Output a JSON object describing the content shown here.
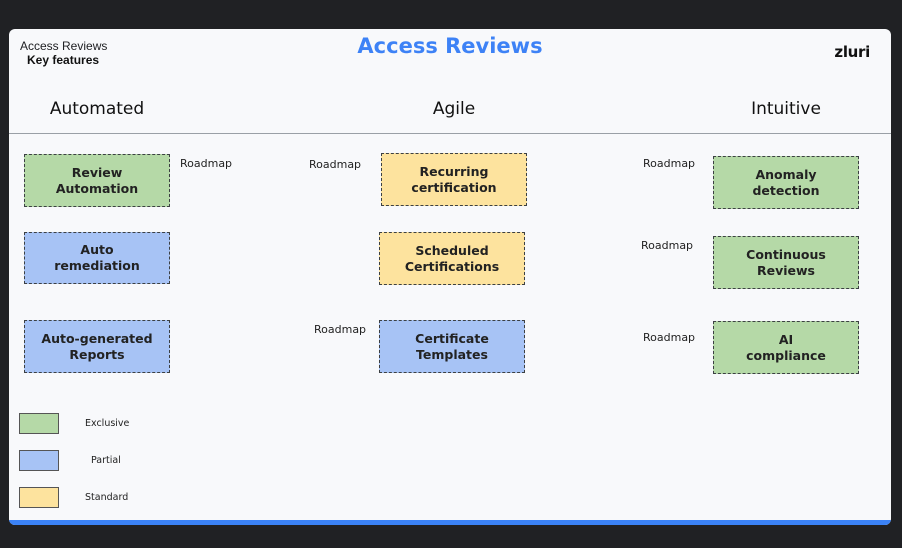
{
  "header": {
    "section_label": "Access Reviews",
    "section_sublabel": "Key features",
    "title": "Access Reviews",
    "logo_text": "zluri"
  },
  "columns": {
    "automated": "Automated",
    "agile": "Agile",
    "intuitive": "Intuitive"
  },
  "features": {
    "review_automation": {
      "label_line1": "Review",
      "label_line2": "Automation",
      "roadmap": "Roadmap",
      "status": "Exclusive"
    },
    "auto_remediation": {
      "label_line1": "Auto",
      "label_line2": "remediation",
      "status": "Partial"
    },
    "auto_generated_reports": {
      "label_line1": "Auto-generated",
      "label_line2": "Reports",
      "status": "Partial"
    },
    "recurring_certification": {
      "label_line1": "Recurring",
      "label_line2": "certification",
      "roadmap": "Roadmap",
      "status": "Standard"
    },
    "scheduled_certifications": {
      "label_line1": "Scheduled",
      "label_line2": "Certifications",
      "status": "Standard"
    },
    "certificate_templates": {
      "label_line1": "Certificate",
      "label_line2": "Templates",
      "roadmap": "Roadmap",
      "status": "Partial"
    },
    "anomaly_detection": {
      "label_line1": "Anomaly",
      "label_line2": "detection",
      "roadmap": "Roadmap",
      "status": "Exclusive"
    },
    "continuous_reviews": {
      "label_line1": "Continuous",
      "label_line2": "Reviews",
      "roadmap": "Roadmap",
      "status": "Exclusive"
    },
    "ai_compliance": {
      "label_line1": "AI",
      "label_line2": "compliance",
      "roadmap": "Roadmap",
      "status": "Exclusive"
    }
  },
  "legend": {
    "exclusive": {
      "label": "Exclusive",
      "color": "#b5d9a7"
    },
    "partial": {
      "label": "Partial",
      "color": "#a7c3f5"
    },
    "standard": {
      "label": "Standard",
      "color": "#fde39e"
    }
  },
  "colors": {
    "accent": "#3d82f6",
    "background": "#f8f9fb",
    "frame": "#202124"
  }
}
